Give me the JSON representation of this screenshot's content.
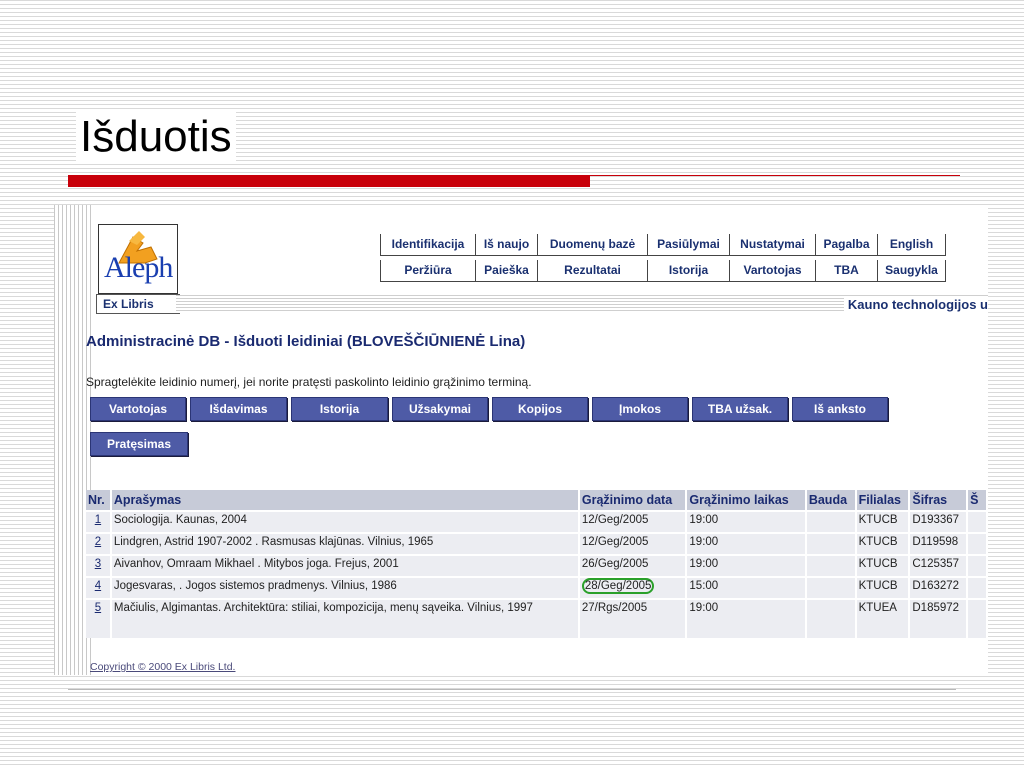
{
  "slide": {
    "title": "Išduotis"
  },
  "logo": {
    "text": "Aleph"
  },
  "header": {
    "exlibris": "Ex Libris",
    "institution": "Kauno technologijos u",
    "nav_row1": [
      "Identifikacija",
      "Iš naujo",
      "Duomenų bazė",
      "Pasiūlymai",
      "Nustatymai",
      "Pagalba",
      "English"
    ],
    "nav_row2": [
      "Peržiūra",
      "Paieška",
      "Rezultatai",
      "Istorija",
      "Vartotojas",
      "TBA",
      "Saugykla"
    ]
  },
  "main": {
    "heading": "Administracinė DB - Išduoti leidiniai (BLOVEŠČIŪNIENĖ Lina)",
    "instruction": "Spragtelėkite leidinio numerį, jei norite pratęsti paskolinto leidinio grąžinimo terminą.",
    "buttons": [
      "Vartotojas",
      "Išdavimas",
      "Istorija",
      "Užsakymai",
      "Kopijos",
      "Įmokos",
      "TBA užsak.",
      "Iš anksto"
    ],
    "renew_button": "Pratęsimas"
  },
  "table": {
    "headers": [
      "Nr.",
      "Aprašymas",
      "Grąžinimo data",
      "Grąžinimo laikas",
      "Bauda",
      "Filialas",
      "Šifras",
      "Š"
    ],
    "rows": [
      {
        "nr": "1",
        "desc": "Sociologija. Kaunas, 2004",
        "date": "12/Geg/2005",
        "time": "19:00",
        "fine": "",
        "branch": "KTUCB",
        "code": "D193367"
      },
      {
        "nr": "2",
        "desc": "Lindgren, Astrid 1907-2002 . Rasmusas klajūnas. Vilnius, 1965",
        "date": "12/Geg/2005",
        "time": "19:00",
        "fine": "",
        "branch": "KTUCB",
        "code": "D119598"
      },
      {
        "nr": "3",
        "desc": "Aivanhov, Omraam Mikhael . Mitybos joga. Frejus, 2001",
        "date": "26/Geg/2005",
        "time": "19:00",
        "fine": "",
        "branch": "KTUCB",
        "code": "C125357"
      },
      {
        "nr": "4",
        "desc": "Jogesvaras, . Jogos sistemos pradmenys. Vilnius, 1986",
        "date": "28/Geg/2005",
        "time": "15:00",
        "fine": "",
        "branch": "KTUCB",
        "code": "D163272"
      },
      {
        "nr": "5",
        "desc": "Mačiulis, Algimantas. Architektūra: stiliai, kompozicija, menų sąveika. Vilnius, 1997",
        "date": "27/Rgs/2005",
        "time": "19:00",
        "fine": "",
        "branch": "KTUEA",
        "code": "D185972"
      }
    ]
  },
  "footer": {
    "copyright": "Copyright © 2000 Ex Libris Ltd."
  },
  "colors": {
    "accent_red": "#c8000a",
    "button_blue": "#4e5ba6",
    "circle_green": "#2aa02a"
  }
}
